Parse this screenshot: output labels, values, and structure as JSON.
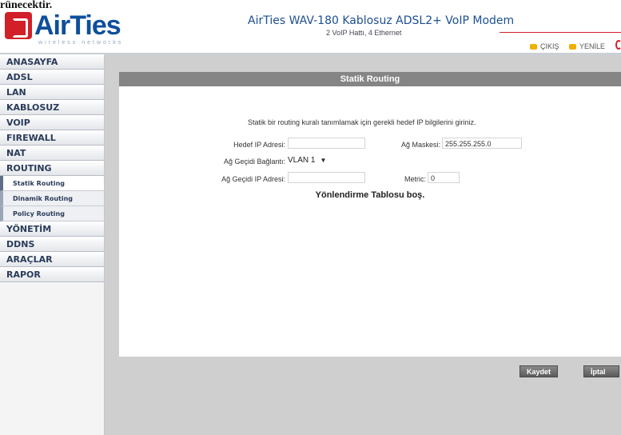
{
  "overlay_text": "rünecektir.",
  "header": {
    "brand": "AirTies",
    "brand_sub": "wireless networks",
    "title": "AirTies WAV-180 Kablosuz ADSL2+ VoIP Modem",
    "subtitle": "2 VoIP Hattı, 4 Ethernet",
    "lang_tr": "ÇIKIŞ",
    "lang_en": "YENİLE"
  },
  "sidebar": {
    "items": [
      {
        "label": "ANASAYFA"
      },
      {
        "label": "ADSL"
      },
      {
        "label": "LAN"
      },
      {
        "label": "KABLOSUZ"
      },
      {
        "label": "VOIP"
      },
      {
        "label": "FIREWALL"
      },
      {
        "label": "NAT"
      },
      {
        "label": "ROUTING"
      }
    ],
    "subitems": [
      {
        "label": "Statik Routing"
      },
      {
        "label": "Dinamik Routing"
      },
      {
        "label": "Policy Routing"
      }
    ],
    "items2": [
      {
        "label": "YÖNETİM"
      },
      {
        "label": "DDNS"
      },
      {
        "label": "ARAÇLAR"
      },
      {
        "label": "RAPOR"
      }
    ]
  },
  "panel": {
    "title": "Statik Routing",
    "description": "Statik bir routing kuralı tanımlamak için gerekli hedef IP bilgilerini giriniz.",
    "dest_ip_label": "Hedef IP Adresi:",
    "dest_ip_value": "",
    "netmask_label": "Ağ Maskesi:",
    "netmask_value": "255.255.255.0",
    "gateway_conn_label": "Ağ Geçidi Bağlantı:",
    "gateway_conn_value": "VLAN 1",
    "gateway_ip_label": "Ağ Geçidi IP Adresi:",
    "gateway_ip_value": "",
    "metric_label": "Metric:",
    "metric_value": "0",
    "empty_message": "Yönlendirme Tablosu boş."
  },
  "buttons": {
    "save": "Kaydet",
    "cancel": "İptal"
  }
}
